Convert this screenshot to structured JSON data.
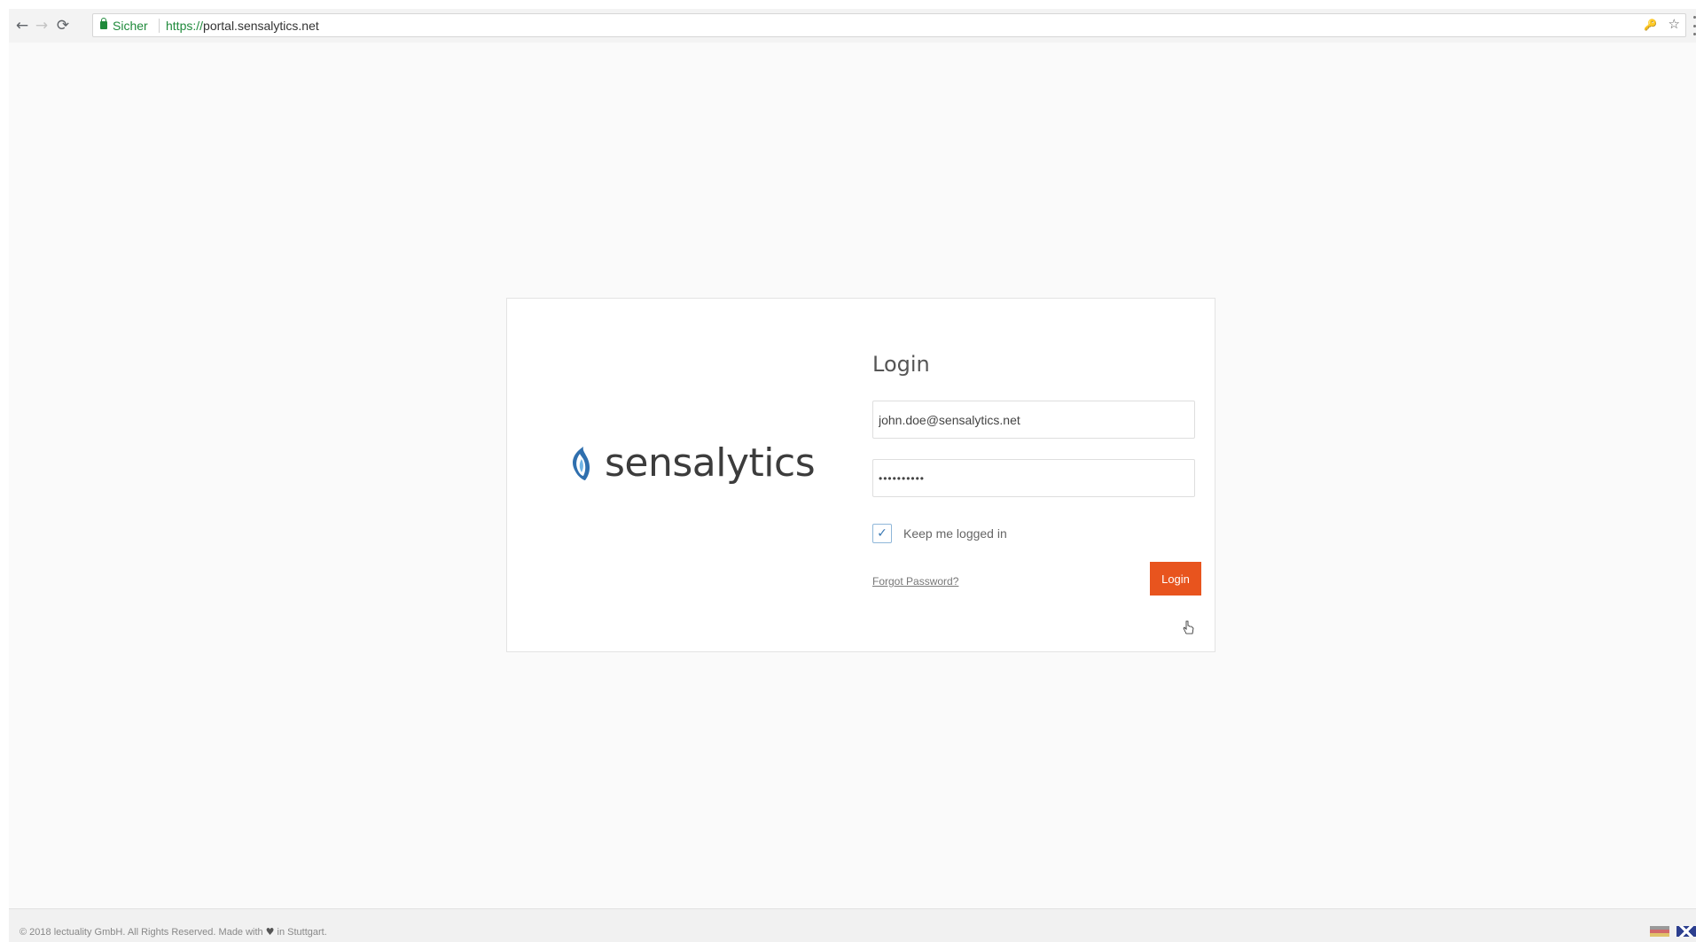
{
  "browser": {
    "secure_label": "Sicher",
    "url_scheme": "https://",
    "url_rest": "portal.sensalytics.net",
    "nav": {
      "back_icon": "←",
      "forward_icon": "→",
      "reload_icon": "⟳"
    },
    "key_icon": "🔑",
    "star_icon": "☆"
  },
  "logo": {
    "text": "sensalytics",
    "accent_color": "#3a86c8"
  },
  "login": {
    "title": "Login",
    "email_value": "john.doe@sensalytics.net",
    "password_value": "••••••••••",
    "keep_logged_in_label": "Keep me logged in",
    "keep_logged_in_checked": true,
    "check_glyph": "✓",
    "forgot_password_label": "Forgot Password?",
    "button_label": "Login",
    "button_color": "#e8541e"
  },
  "footer": {
    "copyright_before": "© 2018 lectuality GmbH. All Rights Reserved. Made with",
    "heart": "♥",
    "copyright_after": "in Stuttgart."
  }
}
